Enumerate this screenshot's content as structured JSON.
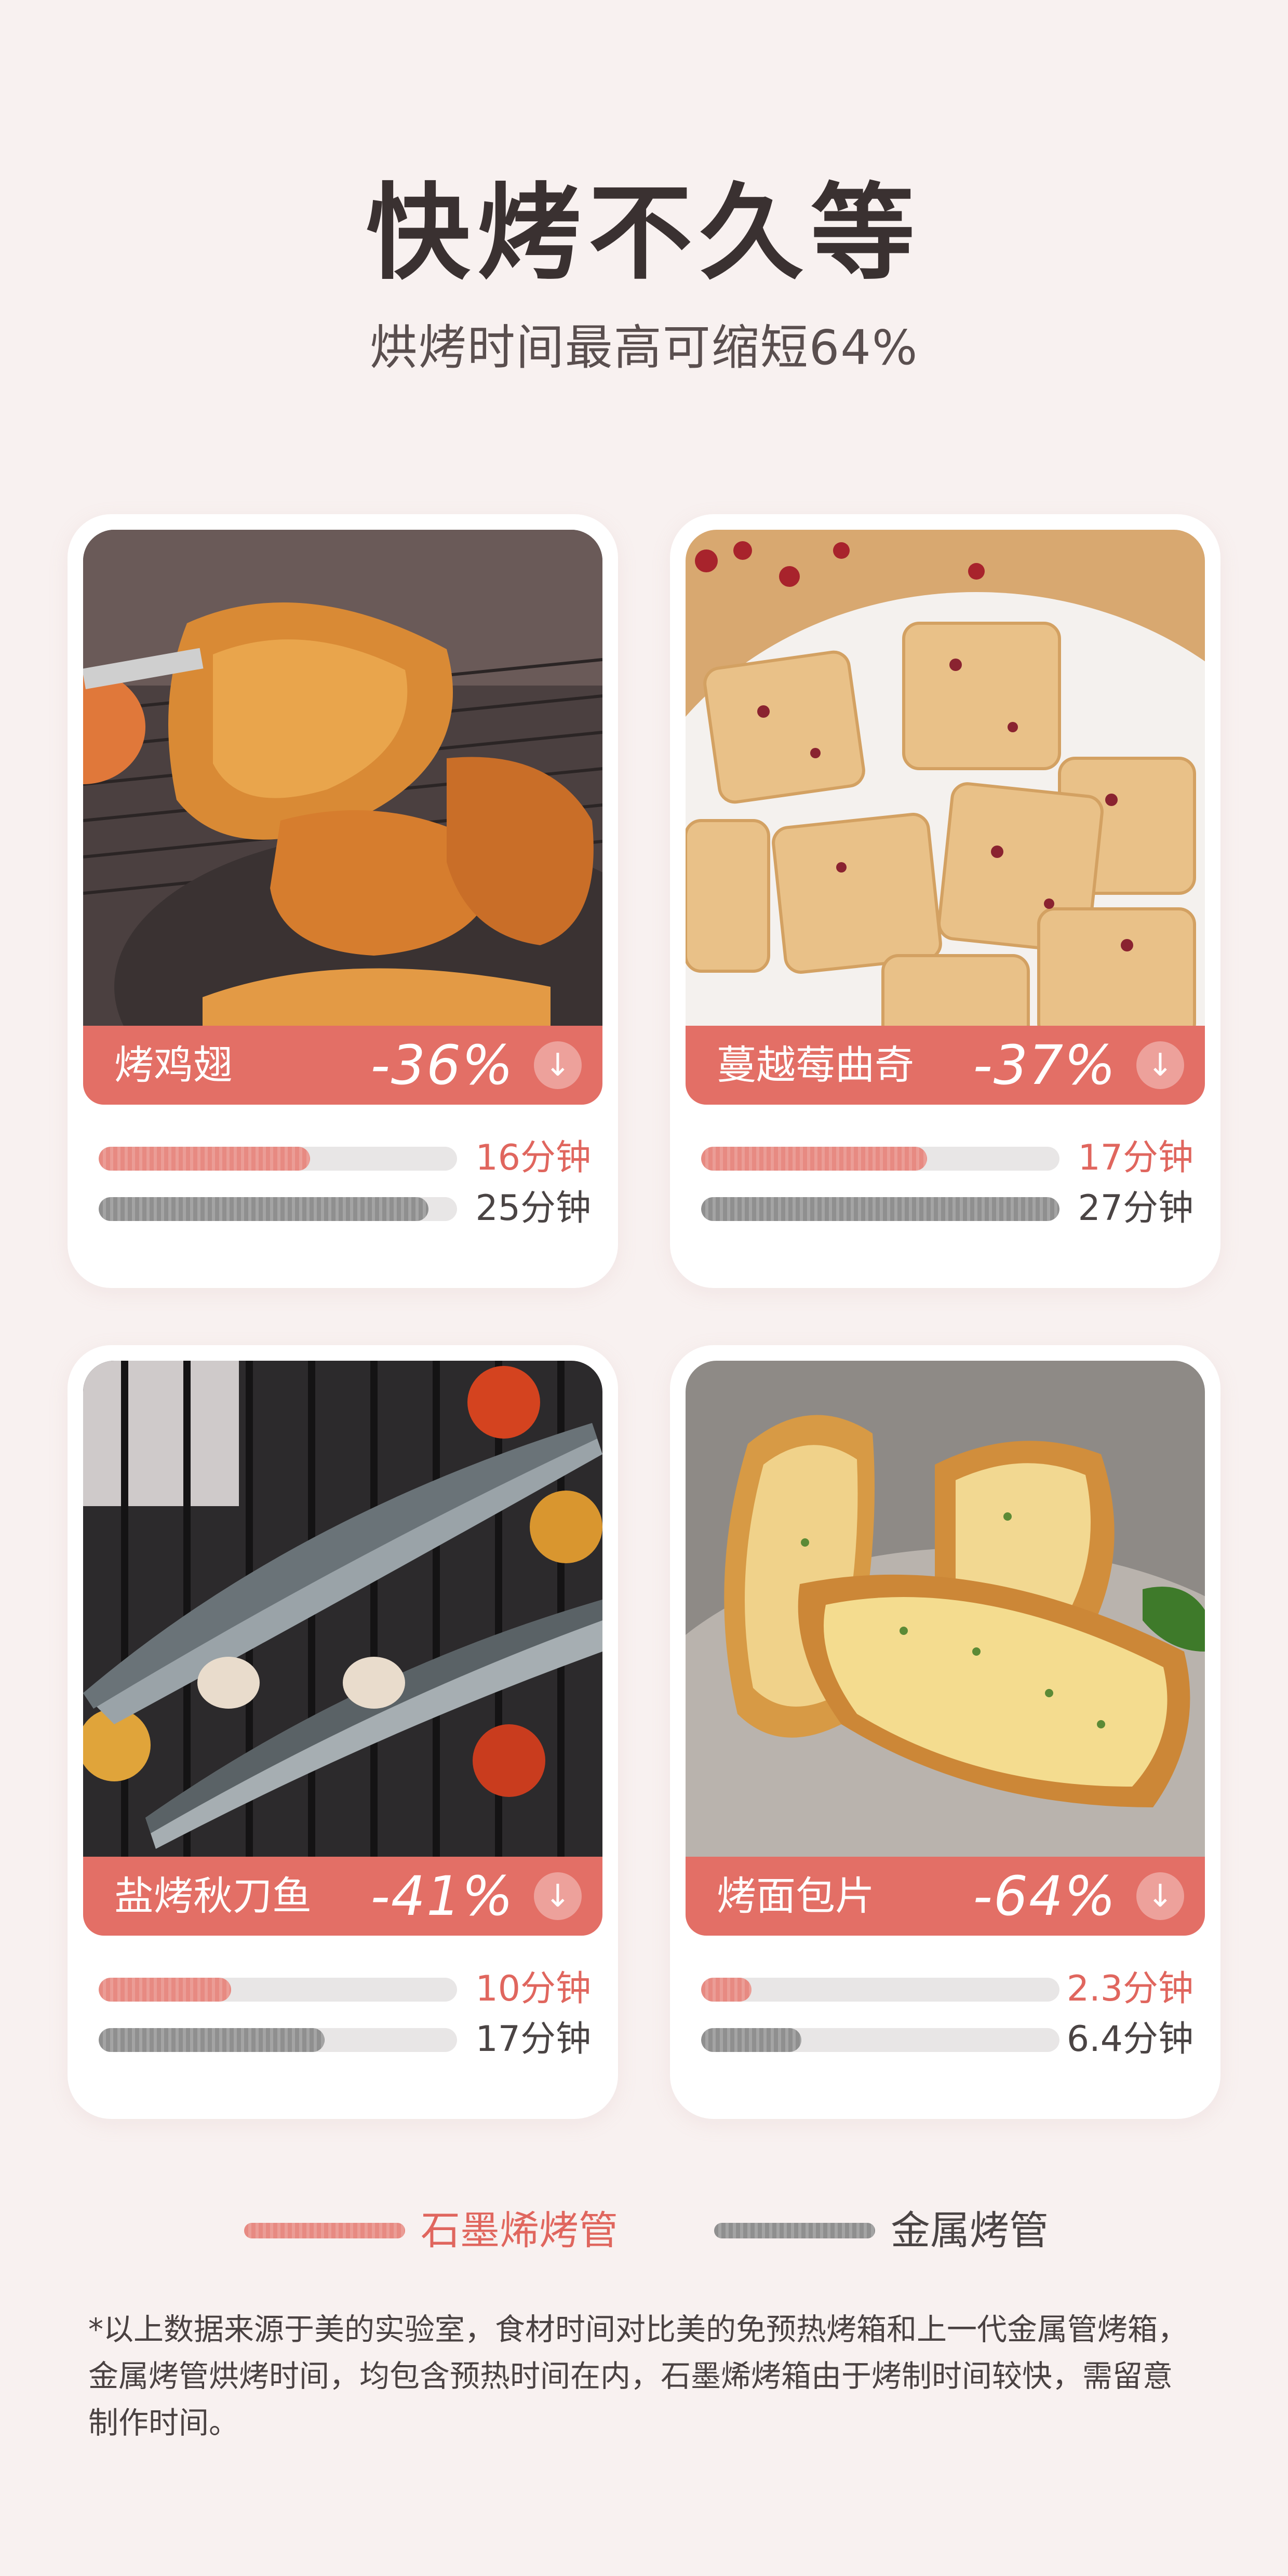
{
  "header": {
    "title": "快烤不久等",
    "subtitle": "烘烤时间最高可缩短64%"
  },
  "cards": [
    {
      "name": "烤鸡翅",
      "percent": "-36%",
      "graphene_time": "16分钟",
      "metal_time": "25分钟",
      "graphene_fraction": 0.59,
      "metal_fraction": 0.92,
      "image_icon": "chicken-wings-image"
    },
    {
      "name": "蔓越莓曲奇",
      "percent": "-37%",
      "graphene_time": "17分钟",
      "metal_time": "27分钟",
      "graphene_fraction": 0.63,
      "metal_fraction": 1.0,
      "image_icon": "cranberry-cookies-image"
    },
    {
      "name": "盐烤秋刀鱼",
      "percent": "-41%",
      "graphene_time": "10分钟",
      "metal_time": "17分钟",
      "graphene_fraction": 0.37,
      "metal_fraction": 0.63,
      "image_icon": "grilled-saury-image"
    },
    {
      "name": "烤面包片",
      "percent": "-64%",
      "graphene_time": "2.3分钟",
      "metal_time": "6.4分钟",
      "graphene_fraction": 0.14,
      "metal_fraction": 0.28,
      "image_icon": "toast-slices-image"
    }
  ],
  "legend": {
    "graphene_label": "石墨烯烤管",
    "metal_label": "金属烤管"
  },
  "footnote": "*以上数据来源于美的实验室，食材时间对比美的免预热烤箱和上一代金属管烤箱，金属烤管烘烤时间，均包含预热时间在内，石墨烯烤箱由于烤制时间较快，需留意制作时间。",
  "colors": {
    "background": "#f8f1f0",
    "accent": "#e36f66",
    "graphene_bar": "#e78a82",
    "metal_bar": "#9a9a9a"
  }
}
